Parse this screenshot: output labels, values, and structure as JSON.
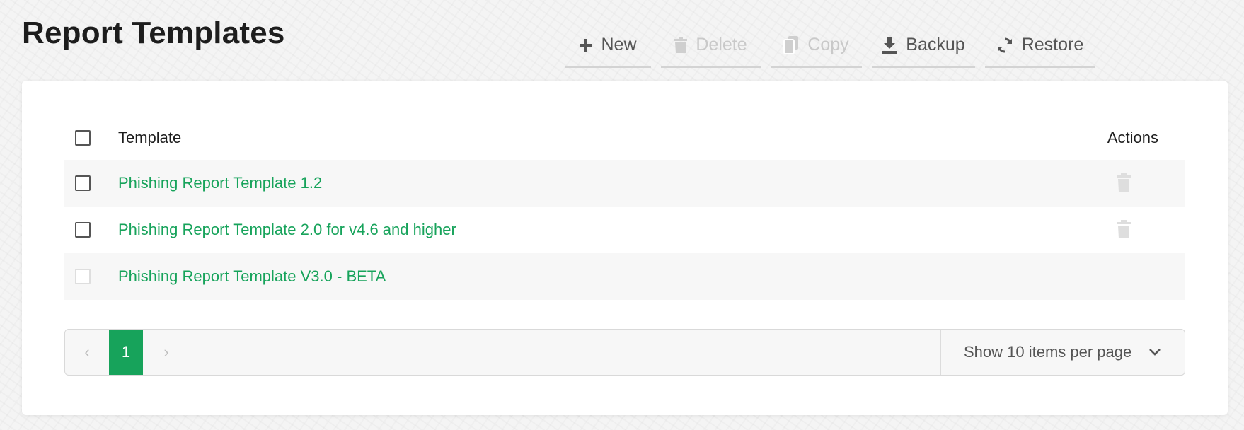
{
  "page": {
    "title": "Report Templates"
  },
  "toolbar": {
    "new_label": "New",
    "delete_label": "Delete",
    "copy_label": "Copy",
    "backup_label": "Backup",
    "restore_label": "Restore"
  },
  "table": {
    "columns": {
      "template": "Template",
      "actions": "Actions"
    },
    "rows": [
      {
        "name": "Phishing Report Template 1.2",
        "selectable": true,
        "deletable": true
      },
      {
        "name": "Phishing Report Template 2.0 for v4.6 and higher",
        "selectable": true,
        "deletable": true
      },
      {
        "name": "Phishing Report Template V3.0 - BETA",
        "selectable": false,
        "deletable": false
      }
    ]
  },
  "pagination": {
    "prev_glyph": "‹",
    "current_page": "1",
    "next_glyph": "›",
    "page_size_label": "Show 10 items per page"
  },
  "colors": {
    "accent": "#17a35b",
    "text": "#1d1d1d",
    "muted": "#c9c9c9"
  },
  "icons": {
    "new": "plus-icon",
    "delete": "trash-icon",
    "copy": "copy-icon",
    "backup": "download-icon",
    "restore": "refresh-icon",
    "dropdown": "chevron-down-icon"
  }
}
